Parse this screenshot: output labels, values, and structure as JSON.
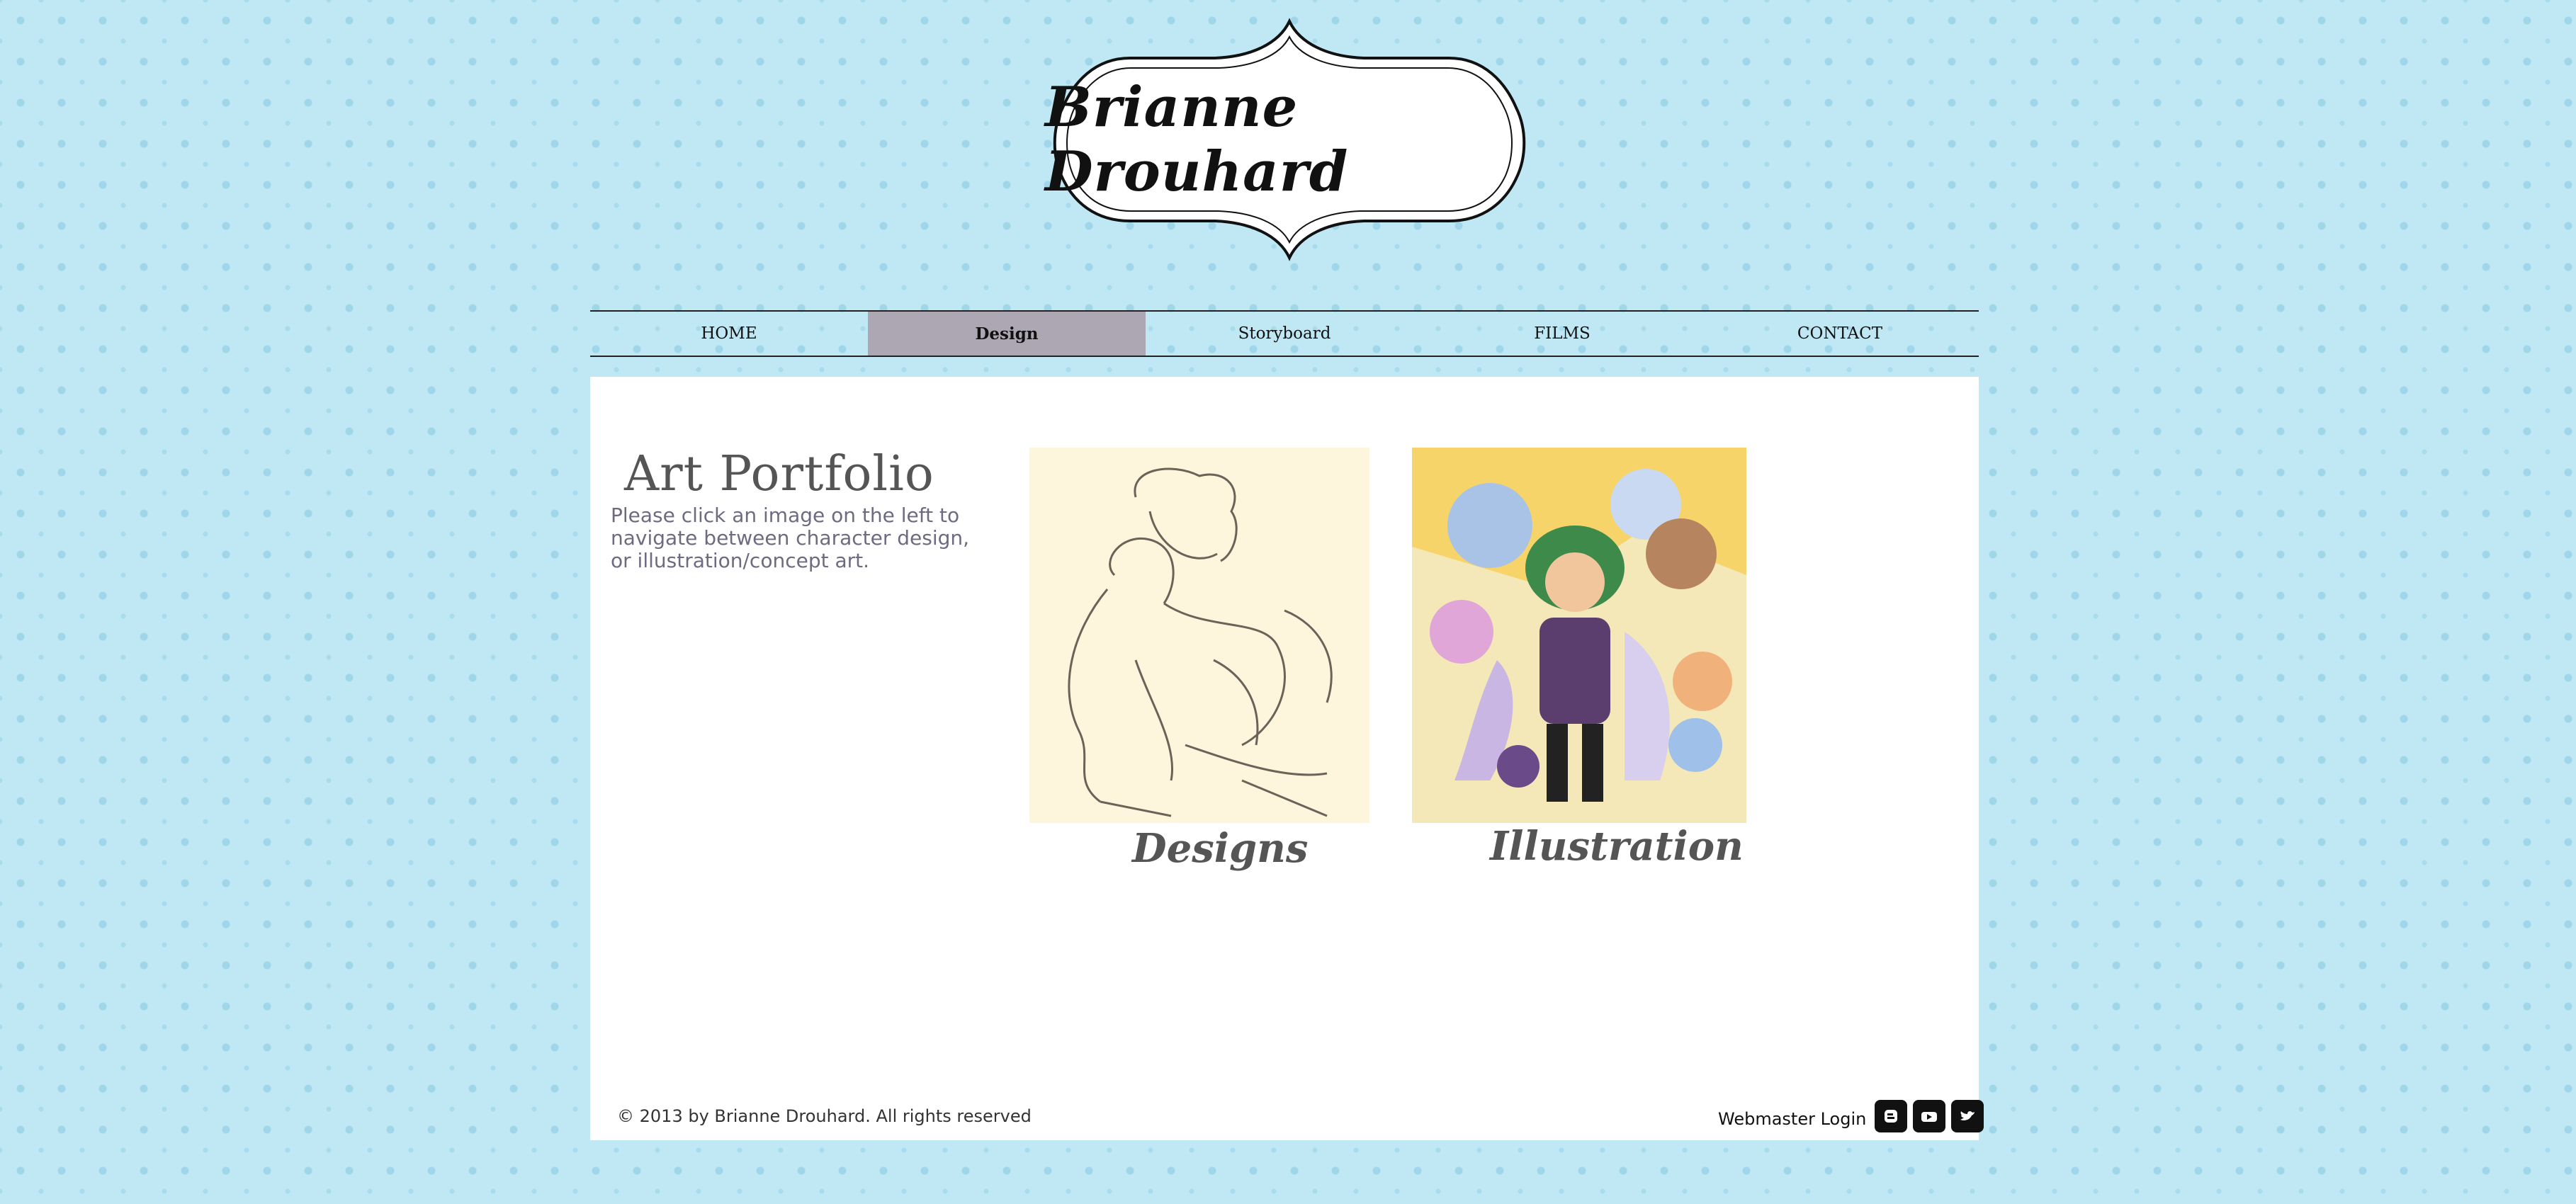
{
  "header": {
    "logo_text": "Brianne Drouhard"
  },
  "nav": {
    "items": [
      {
        "label": "HOME",
        "active": false
      },
      {
        "label": "Design",
        "active": true
      },
      {
        "label": "Storyboard",
        "active": false
      },
      {
        "label": "FILMS",
        "active": false
      },
      {
        "label": "CONTACT",
        "active": false
      }
    ]
  },
  "main": {
    "title": "Art Portfolio",
    "description": "Please click an image on the left to navigate between character design, or illustration/concept art.",
    "gallery": [
      {
        "caption": "Designs",
        "icon": "character-sketch-image"
      },
      {
        "caption": "Illustration",
        "icon": "character-illustration-image"
      }
    ]
  },
  "footer": {
    "copyright": "© 2013 by Brianne Drouhard. All rights reserved",
    "webmaster_login": "Webmaster Login",
    "social": [
      "blogger-icon",
      "youtube-icon",
      "twitter-icon"
    ]
  },
  "colors": {
    "background": "#bfe8f4",
    "nav_active": "#ada6b3",
    "panel": "#ffffff",
    "description_text": "#6f6a80"
  }
}
